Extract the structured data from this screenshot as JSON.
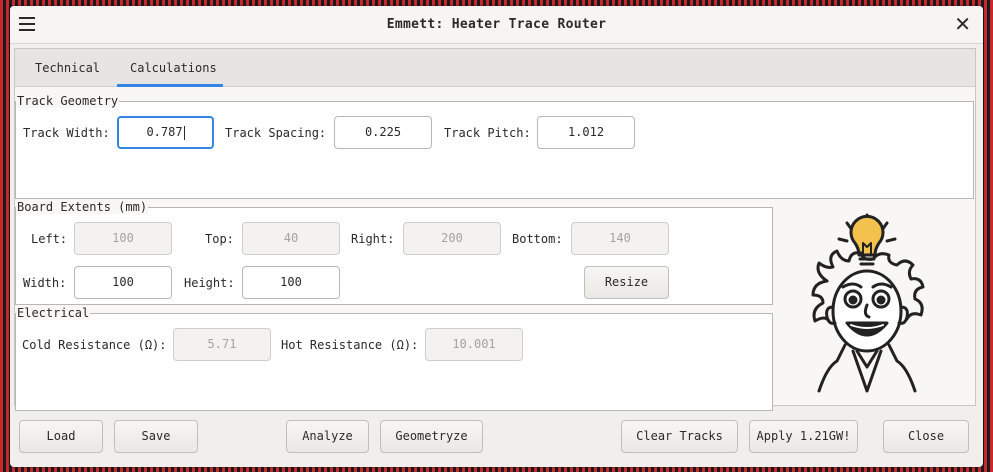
{
  "window": {
    "title": "Emmett: Heater Trace Router"
  },
  "tabs": [
    {
      "label": "Technical"
    },
    {
      "label": "Calculations"
    }
  ],
  "track_geometry": {
    "legend": "Track Geometry",
    "track_width_label": "Track Width:",
    "track_width_value": "0.787",
    "track_spacing_label": "Track Spacing:",
    "track_spacing_value": "0.225",
    "track_pitch_label": "Track Pitch:",
    "track_pitch_value": "1.012"
  },
  "board_extents": {
    "legend": "Board Extents (mm)",
    "left_label": "Left:",
    "left_value": "100",
    "top_label": "Top:",
    "top_value": "40",
    "right_label": "Right:",
    "right_value": "200",
    "bottom_label": "Bottom:",
    "bottom_value": "140",
    "width_label": "Width:",
    "width_value": "100",
    "height_label": "Height:",
    "height_value": "100",
    "resize_label": "Resize"
  },
  "electrical": {
    "legend": "Electrical",
    "cold_label": "Cold Resistance (Ω):",
    "cold_value": "5.71",
    "hot_label": "Hot Resistance (Ω):",
    "hot_value": "10.001"
  },
  "buttons": {
    "load": "Load",
    "save": "Save",
    "analyze": "Analyze",
    "geometryze": "Geometryze",
    "clear_tracks": "Clear Tracks",
    "apply": "Apply 1.21GW!",
    "close": "Close"
  },
  "icons": {
    "menu": "hamburger-menu-icon",
    "close": "close-icon",
    "mascot": "scientist-lightbulb-icon"
  },
  "colors": {
    "accent": "#3584e4",
    "background_stripe_red": "#c8282d",
    "background_stripe_dark": "#1a1a1a",
    "bulb": "#f2c14e"
  }
}
